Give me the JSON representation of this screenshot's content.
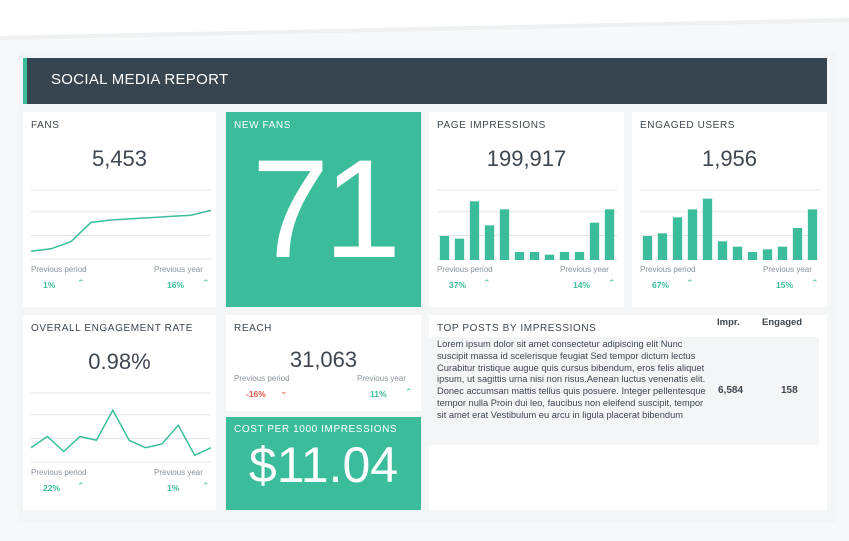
{
  "report": {
    "title": "SOCIAL MEDIA REPORT"
  },
  "colors": {
    "accent": "#3bbd9c",
    "header": "#36454f",
    "negative": "#e0584c"
  },
  "fans": {
    "label": "FANS",
    "value": "5,453",
    "prev_label": "Previous period",
    "prev_value": "1%",
    "year_label": "Previous year",
    "year_value": "16%",
    "series": [
      2,
      3,
      6,
      14,
      15,
      15.5,
      16,
      16.5,
      17,
      19
    ]
  },
  "new_fans": {
    "label": "NEW FANS",
    "value": "71"
  },
  "page_impressions": {
    "label": "PAGE IMPRESSIONS",
    "value": "199,917",
    "prev_label": "Previous period",
    "prev_value": "37%",
    "year_label": "Previous year",
    "year_value": "14%",
    "bars": [
      9,
      8,
      22,
      13,
      19,
      3,
      3,
      2,
      3,
      3,
      14,
      19
    ]
  },
  "engaged_users": {
    "label": "ENGAGED USERS",
    "value": "1,956",
    "prev_label": "Previous period",
    "prev_value": "67%",
    "year_label": "Previous year",
    "year_value": "15%",
    "bars": [
      9,
      10,
      16,
      19,
      23,
      7,
      5,
      3,
      4,
      5,
      12,
      19
    ]
  },
  "engagement_rate": {
    "label": "OVERALL ENGAGEMENT RATE",
    "value": "0.98%",
    "prev_label": "Previous period",
    "prev_value": "22%",
    "year_label": "Previous year",
    "year_value": "1%",
    "series": [
      3,
      6,
      2,
      6,
      5,
      13,
      5,
      3,
      4,
      9,
      1,
      3
    ]
  },
  "reach": {
    "label": "REACH",
    "value": "31,063",
    "prev_label": "Previous period",
    "prev_value": "-16%",
    "year_label": "Previous year",
    "year_value": "11%"
  },
  "cost_per_1000": {
    "label": "COST PER 1000 IMPRESSIONS",
    "value": "$11.04"
  },
  "top_posts": {
    "label": "TOP POSTS BY IMPRESSIONS",
    "col_impr": "Impr.",
    "col_engaged": "Engaged",
    "rows": [
      {
        "text": "Lorem ipsum dolor sit amet consectetur adipiscing elit Nunc suscipit massa id scelerisque feugiat Sed tempor dictum lectus Curabitur tristique augue quis cursus bibendum, eros felis aliquet ipsum, ut sagittis urna nisi non risus.Aenean luctus venenatis elit. Donec accumsan mattis tellus quis posuere. Integer pellentesque tempor nulla Proin dui leo, faucibus non eleifend suscipit, tempor sit amet erat Vestibulum eu arcu in ligula placerat bibendum",
        "impr": "6,584",
        "engaged": "158"
      }
    ]
  }
}
